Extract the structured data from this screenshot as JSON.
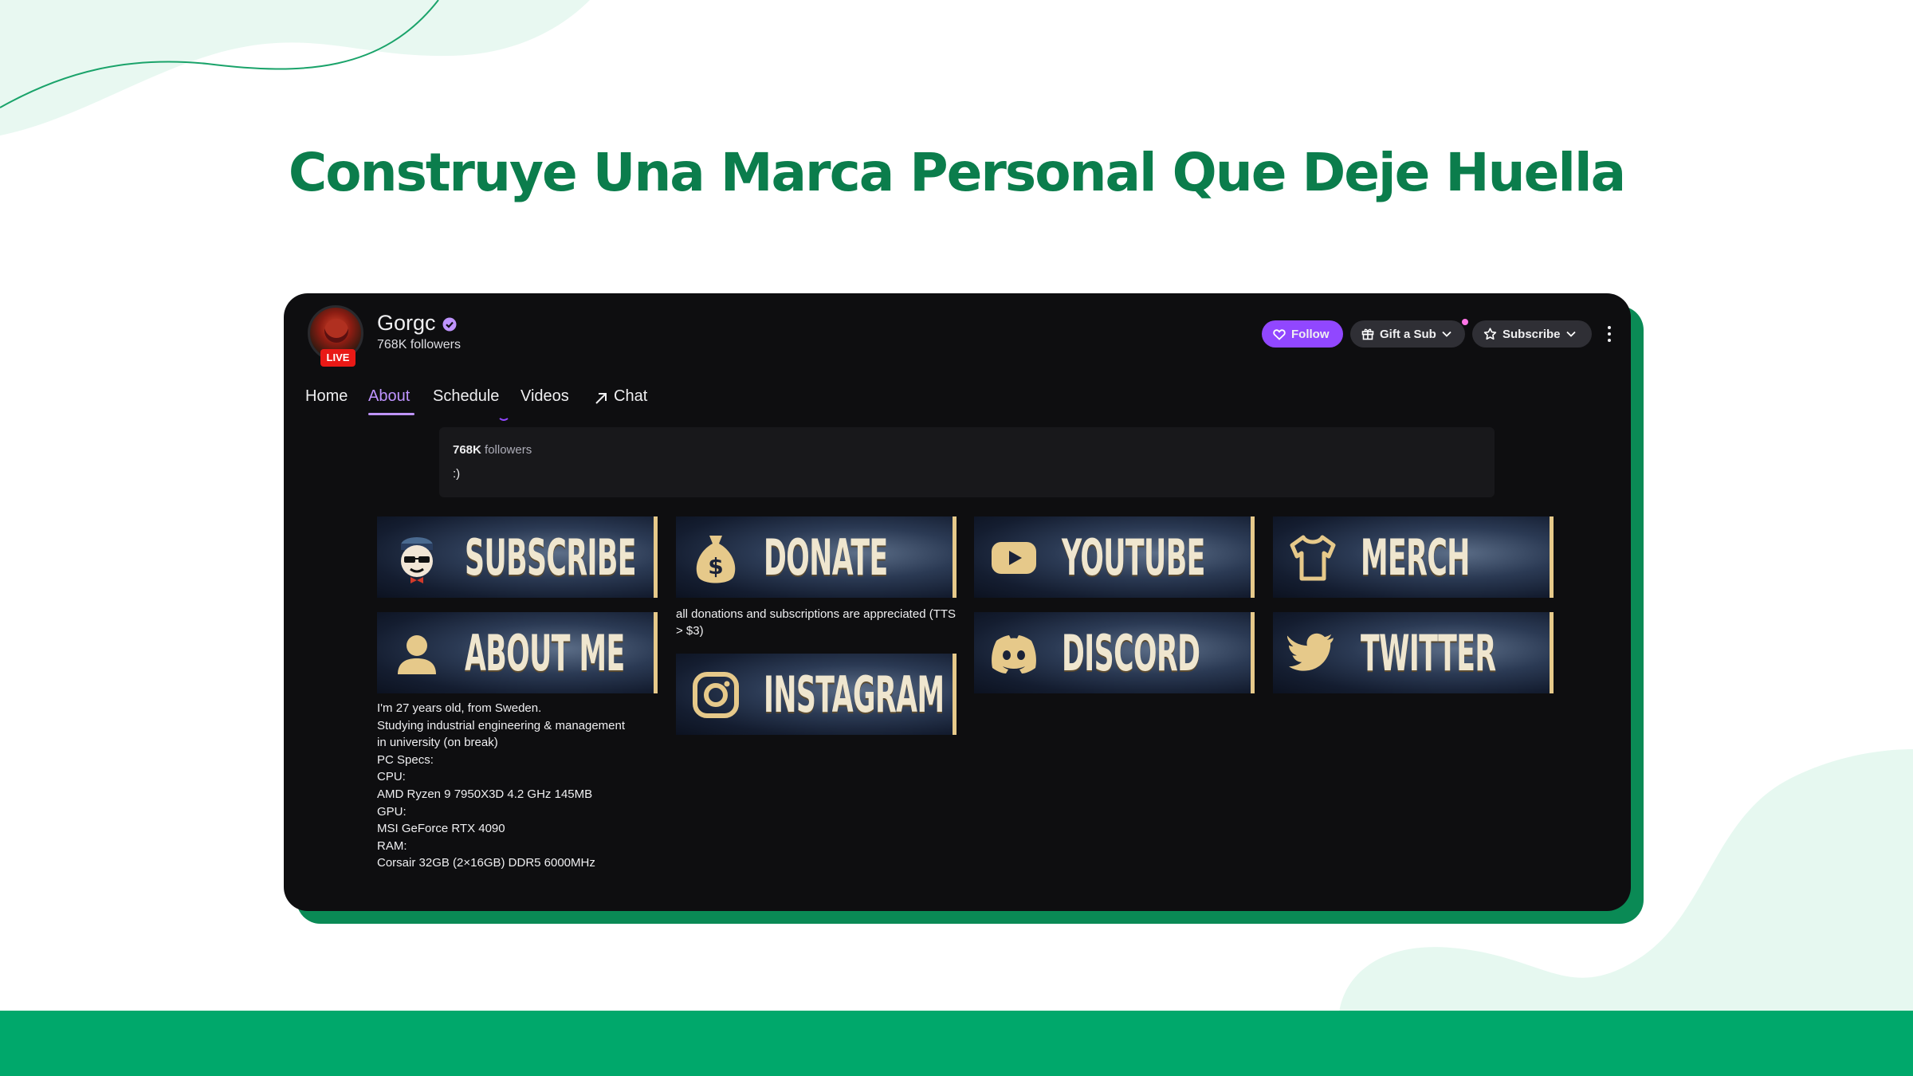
{
  "headline": "Construye Una Marca Personal Que Deje Huella",
  "colors": {
    "brand_green": "#0b7d4c",
    "band_green": "#00a86b",
    "twitch_purple": "#9147ff",
    "panel_gold": "#e6c98a",
    "live_red": "#e91916"
  },
  "channel": {
    "name": "Gorgc",
    "followers_label": "768K followers",
    "live_badge": "LIVE",
    "verified_icon": "verified-badge-icon"
  },
  "actions": {
    "follow": "Follow",
    "gift": "Gift a Sub",
    "subscribe": "Subscribe"
  },
  "tabs": [
    "Home",
    "About",
    "Schedule",
    "Videos",
    "Chat"
  ],
  "active_tab": "About",
  "about": {
    "followers_count": "768K",
    "followers_word": "followers",
    "bio": ":)"
  },
  "panels": {
    "subscribe": "SUBSCRIBE",
    "donate": "DONATE",
    "youtube": "YOUTUBE",
    "merch": "MERCH",
    "about_me": "ABOUT ME",
    "instagram": "INSTAGRAM",
    "discord": "DISCORD",
    "twitter": "TWITTER"
  },
  "donate_text": "all donations and subscriptions are appreciated (TTS > $3)",
  "about_lines": [
    "I'm 27 years old, from Sweden.",
    "Studying industrial engineering & management",
    "in university (on break)",
    "PC Specs:",
    "CPU:",
    "AMD Ryzen 9 7950X3D 4.2 GHz 145MB",
    "GPU:",
    "MSI GeForce RTX 4090",
    "RAM:",
    "Corsair 32GB (2×16GB) DDR5 6000MHz"
  ]
}
